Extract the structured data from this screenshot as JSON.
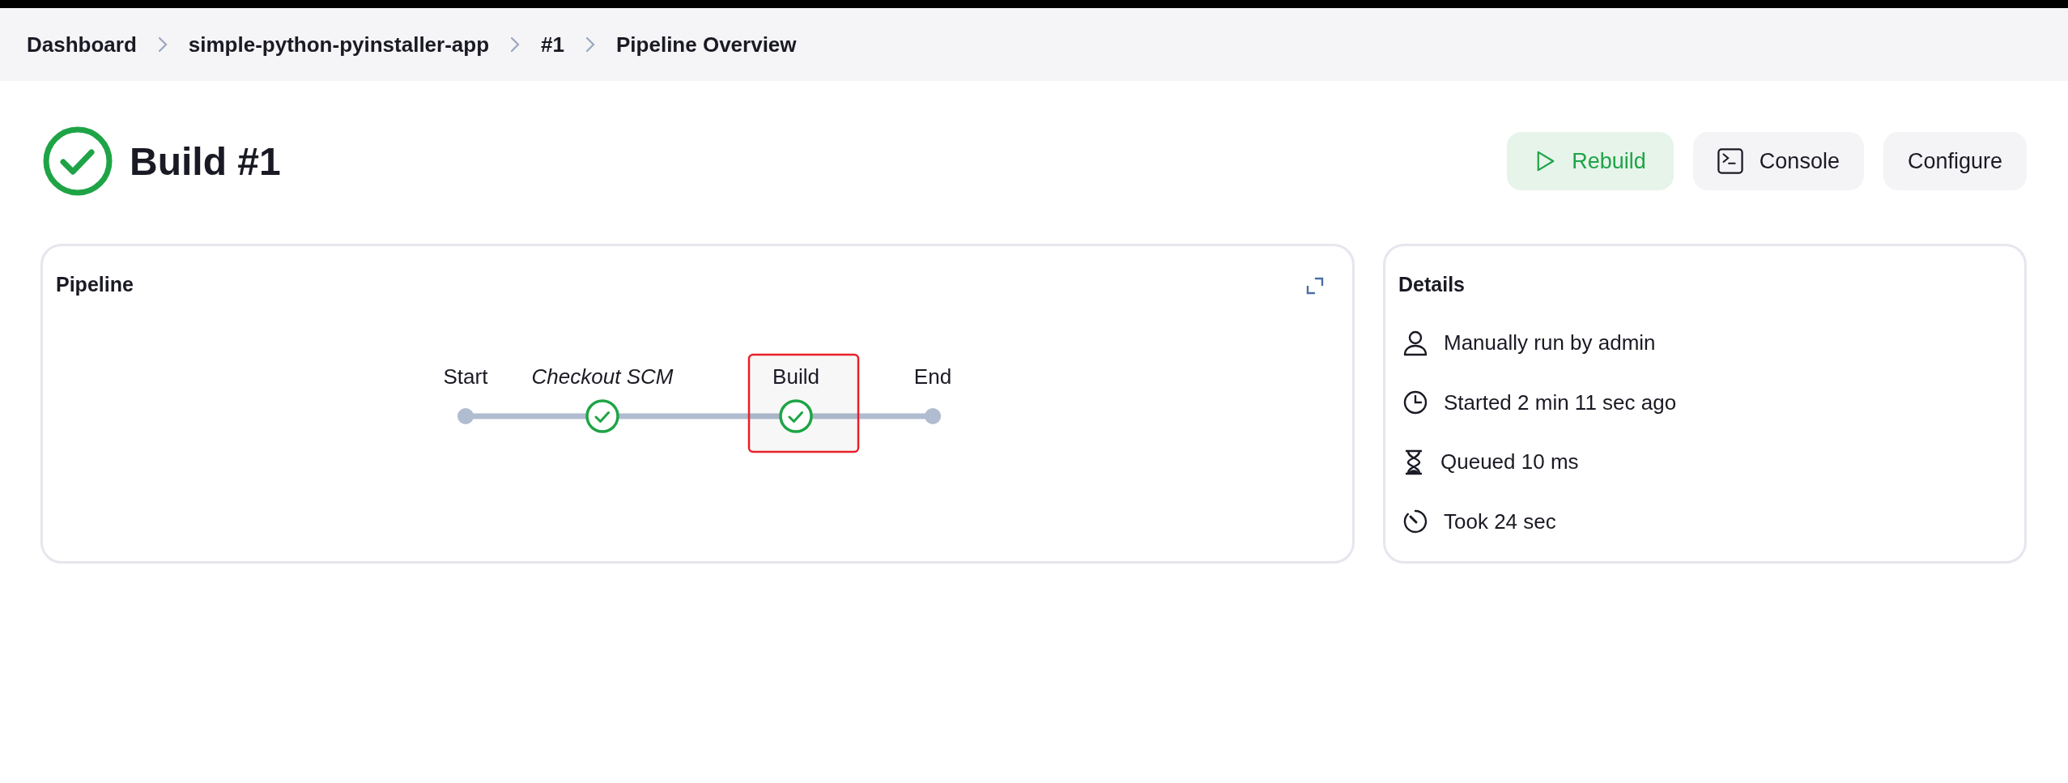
{
  "breadcrumbs": [
    "Dashboard",
    "simple-python-pyinstaller-app",
    "#1",
    "Pipeline Overview"
  ],
  "build": {
    "title": "Build #1",
    "passed": true
  },
  "actions": [
    {
      "label": "Rebuild",
      "kind": "rebuild"
    },
    {
      "label": "Console",
      "kind": "console"
    },
    {
      "label": "Configure",
      "kind": "plain"
    }
  ],
  "pipeline": {
    "title": "Pipeline",
    "nodes": [
      {
        "label": "Start",
        "kind": "terminal",
        "selected": false
      },
      {
        "label": "Checkout SCM",
        "kind": "synthetic",
        "passed": true,
        "selected": false
      },
      {
        "label": "Build",
        "kind": "stage",
        "passed": true,
        "selected": true
      },
      {
        "label": "End",
        "kind": "terminal",
        "selected": false
      }
    ]
  },
  "details": {
    "title": "Details",
    "items": [
      {
        "text": "Manually run by admin",
        "kind": "user"
      },
      {
        "text": "Started 2 min 11 sec ago",
        "kind": "clock"
      },
      {
        "text": "Queued 10 ms",
        "kind": "hourglass"
      },
      {
        "text": "Took 24 sec",
        "kind": "timer"
      }
    ]
  }
}
